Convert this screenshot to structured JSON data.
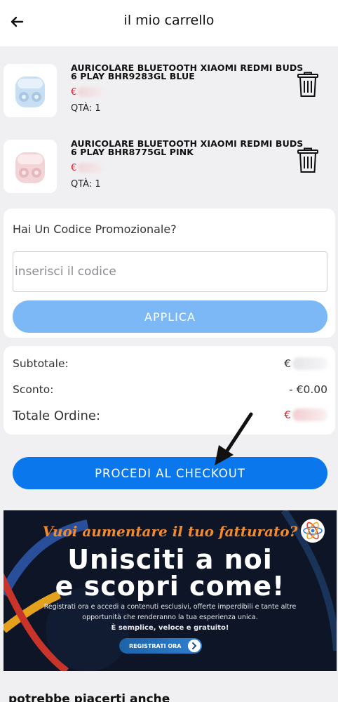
{
  "header": {
    "title": "il mio carrello"
  },
  "cart": {
    "items": [
      {
        "name": "AURICOLARE BLUETOOTH XIAOMI REDMI BUDS 6 PLAY BHR9283GL BLUE",
        "currency": "€",
        "qty": "QTÀ: 1",
        "color_theme": "#b9d6ee"
      },
      {
        "name": "AURICOLARE BLUETOOTH XIAOMI REDMI BUDS 6 PLAY BHR8775GL PINK",
        "currency": "€",
        "qty": "QTÀ: 1",
        "color_theme": "#f1ccd0"
      }
    ]
  },
  "promo": {
    "label": "Hai Un Codice Promozionale?",
    "placeholder": "inserisci il codice",
    "apply_label": "APPLICA"
  },
  "summary": {
    "subtotal_label": "Subtotale:",
    "subtotal_currency": "€",
    "discount_label": "Sconto:",
    "discount_value": "- €0.00",
    "total_label": "Totale Ordine:",
    "total_currency": "€"
  },
  "checkout": {
    "label": "PROCEDI AL CHECKOUT"
  },
  "banner": {
    "headline": "Vuoi aumentare il tuo fatturato?",
    "big_line1": "Unisciti a noi",
    "big_line2": "e scopri come!",
    "body": "Registrati ora e accedi a contenuti esclusivi, offerte imperdibili e tante altre opportunità che renderanno la tua esperienza unica.",
    "tagline": "È semplice, veloce e gratuito!",
    "cta": "REGISTRATI ORA"
  },
  "recommendations": {
    "title": "potrebbe piacerti anche"
  },
  "colors": {
    "accent": "#0a77ec",
    "apply_button": "#7bb8f5",
    "price_red": "#e31e2c",
    "banner_orange": "#f28a2e"
  }
}
